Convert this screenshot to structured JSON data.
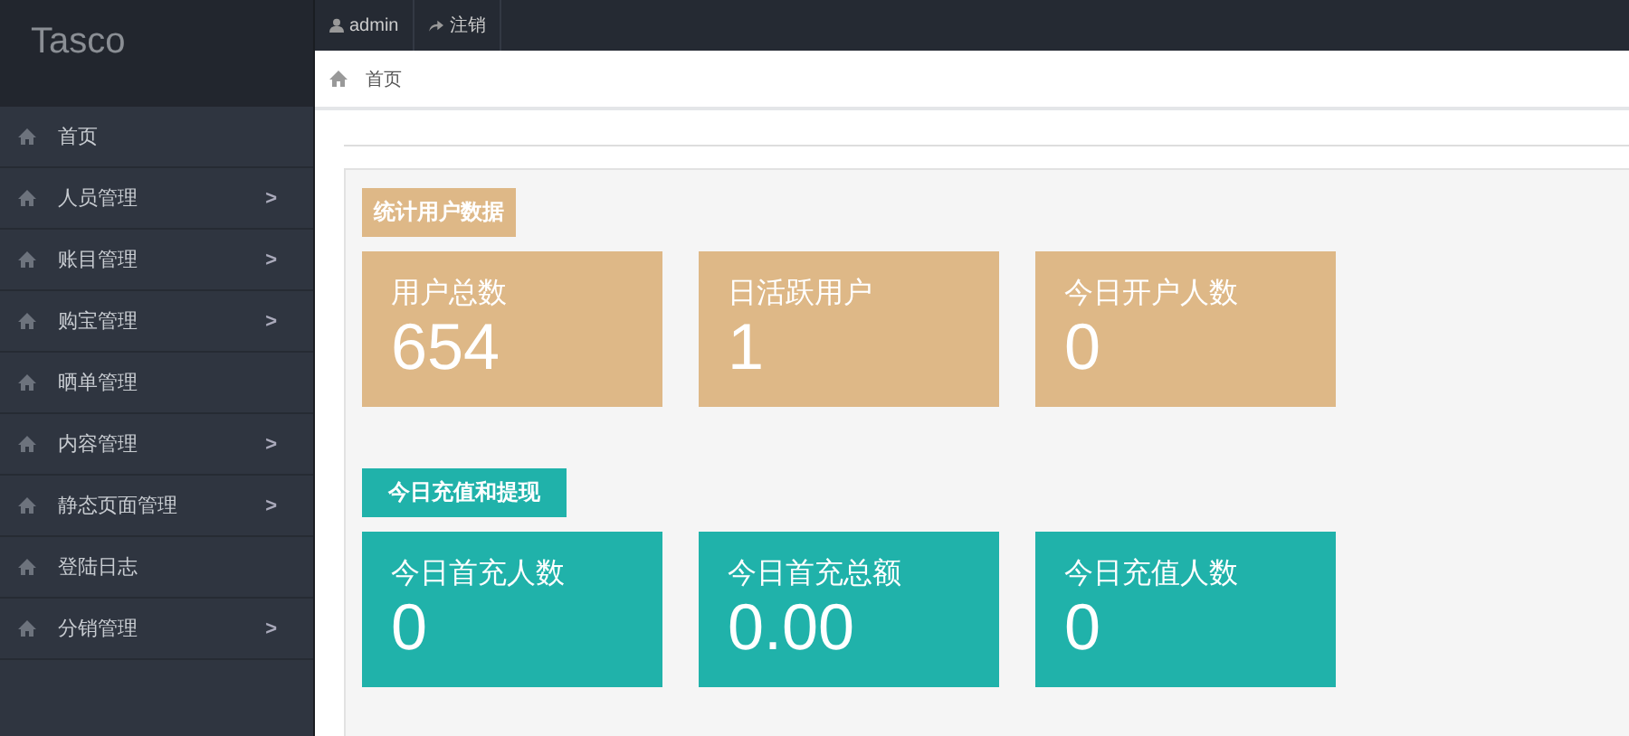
{
  "logo": "Tasco",
  "topbar": [
    {
      "kind": "user",
      "label": "admin"
    },
    {
      "kind": "logout",
      "label": "注销"
    }
  ],
  "sidebar": {
    "items": [
      {
        "label": "首页"
      },
      {
        "label": "人员管理",
        "arrow": ">"
      },
      {
        "label": "账目管理",
        "arrow": ">"
      },
      {
        "label": "购宝管理",
        "arrow": ">"
      },
      {
        "label": "晒单管理"
      },
      {
        "label": "内容管理",
        "arrow": ">"
      },
      {
        "label": "静态页面管理",
        "arrow": ">"
      },
      {
        "label": "登陆日志"
      },
      {
        "label": "分销管理",
        "arrow": ">"
      }
    ]
  },
  "breadcrumb": "首页",
  "sections": [
    {
      "title": "统计用户数据",
      "color": "#deb887",
      "cards": [
        {
          "label": "用户总数",
          "value": "654"
        },
        {
          "label": "日活跃用户",
          "value": "1"
        },
        {
          "label": "今日开户人数",
          "value": "0"
        }
      ]
    },
    {
      "title": "今日充值和提现",
      "color": "#20b2aa",
      "cards": [
        {
          "label": "今日首充人数",
          "value": "0"
        },
        {
          "label": "今日首充总额",
          "value": "0.00"
        },
        {
          "label": "今日充值人数",
          "value": "0"
        }
      ]
    }
  ]
}
